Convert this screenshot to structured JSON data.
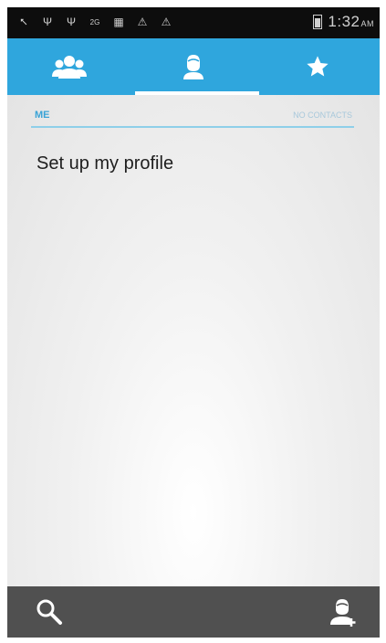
{
  "status_bar": {
    "time": "1:32",
    "ampm": "AM",
    "icons": [
      "usb-icon",
      "usb-icon",
      "usb-icon",
      "2g-icon",
      "sd-card-icon",
      "warning-icon",
      "warning-icon",
      "battery-icon"
    ]
  },
  "tabs": [
    {
      "name": "groups",
      "icon": "groups-icon",
      "selected": false
    },
    {
      "name": "me",
      "icon": "person-icon",
      "selected": true
    },
    {
      "name": "favorites",
      "icon": "star-icon",
      "selected": false
    }
  ],
  "section": {
    "title": "ME",
    "count": "NO CONTACTS"
  },
  "profile": {
    "setup_label": "Set up my profile"
  },
  "bottom_bar": {
    "search_icon": "search-icon",
    "add_contact_icon": "add-contact-icon"
  },
  "colors": {
    "accent": "#2fa6dd",
    "status_bar": "#0d0d0d",
    "bottom_bar": "#505050",
    "section_text": "#3aa3d6"
  }
}
